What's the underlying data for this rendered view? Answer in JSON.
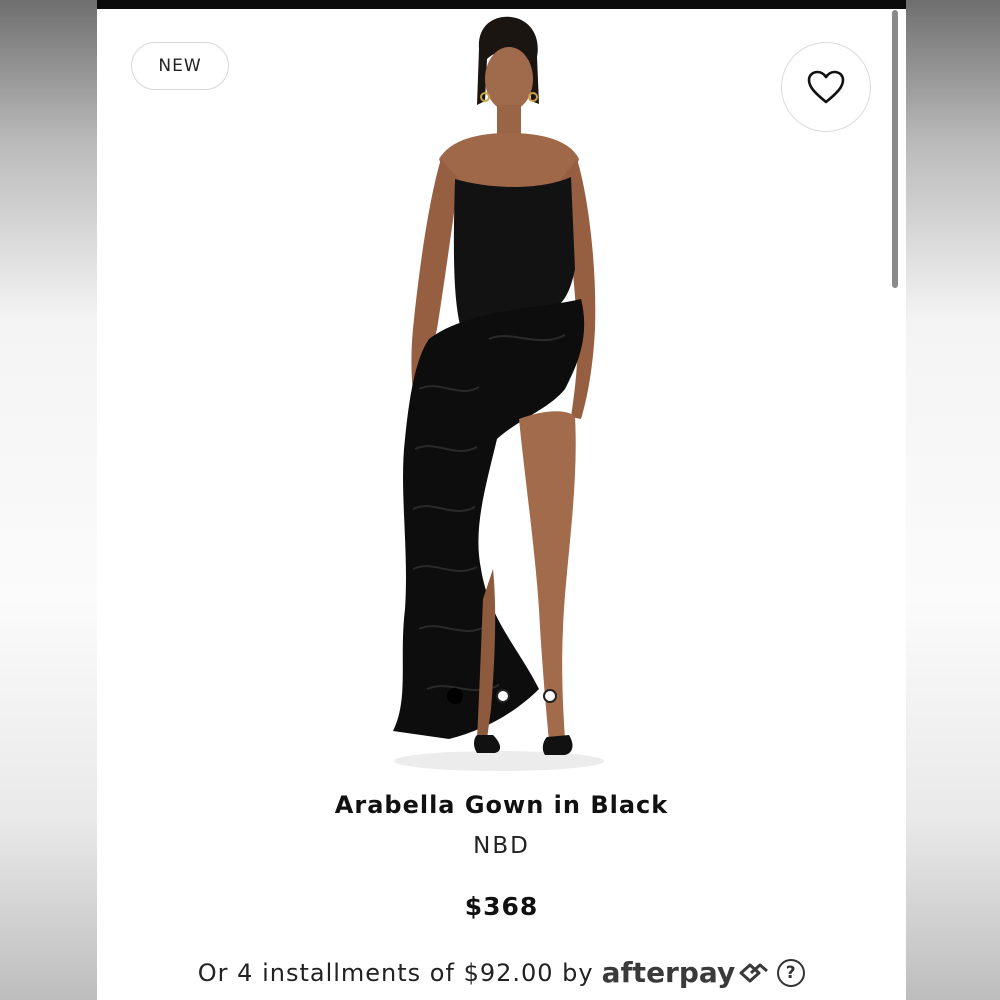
{
  "badge": {
    "label": "NEW"
  },
  "wishlist": {
    "icon": "heart-icon"
  },
  "gallery": {
    "total_images": 3,
    "active_index": 0
  },
  "product": {
    "name": "Arabella Gown in Black",
    "brand": "NBD",
    "price": "$368"
  },
  "payment": {
    "prefix": "Or 4 installments of $92.00 by",
    "provider": "afterpay",
    "provider_icon": "afterpay-logo-icon",
    "help_label": "?"
  },
  "colors": {
    "accent": "#000000",
    "badge_border": "#d8d8d8",
    "text": "#111111"
  }
}
